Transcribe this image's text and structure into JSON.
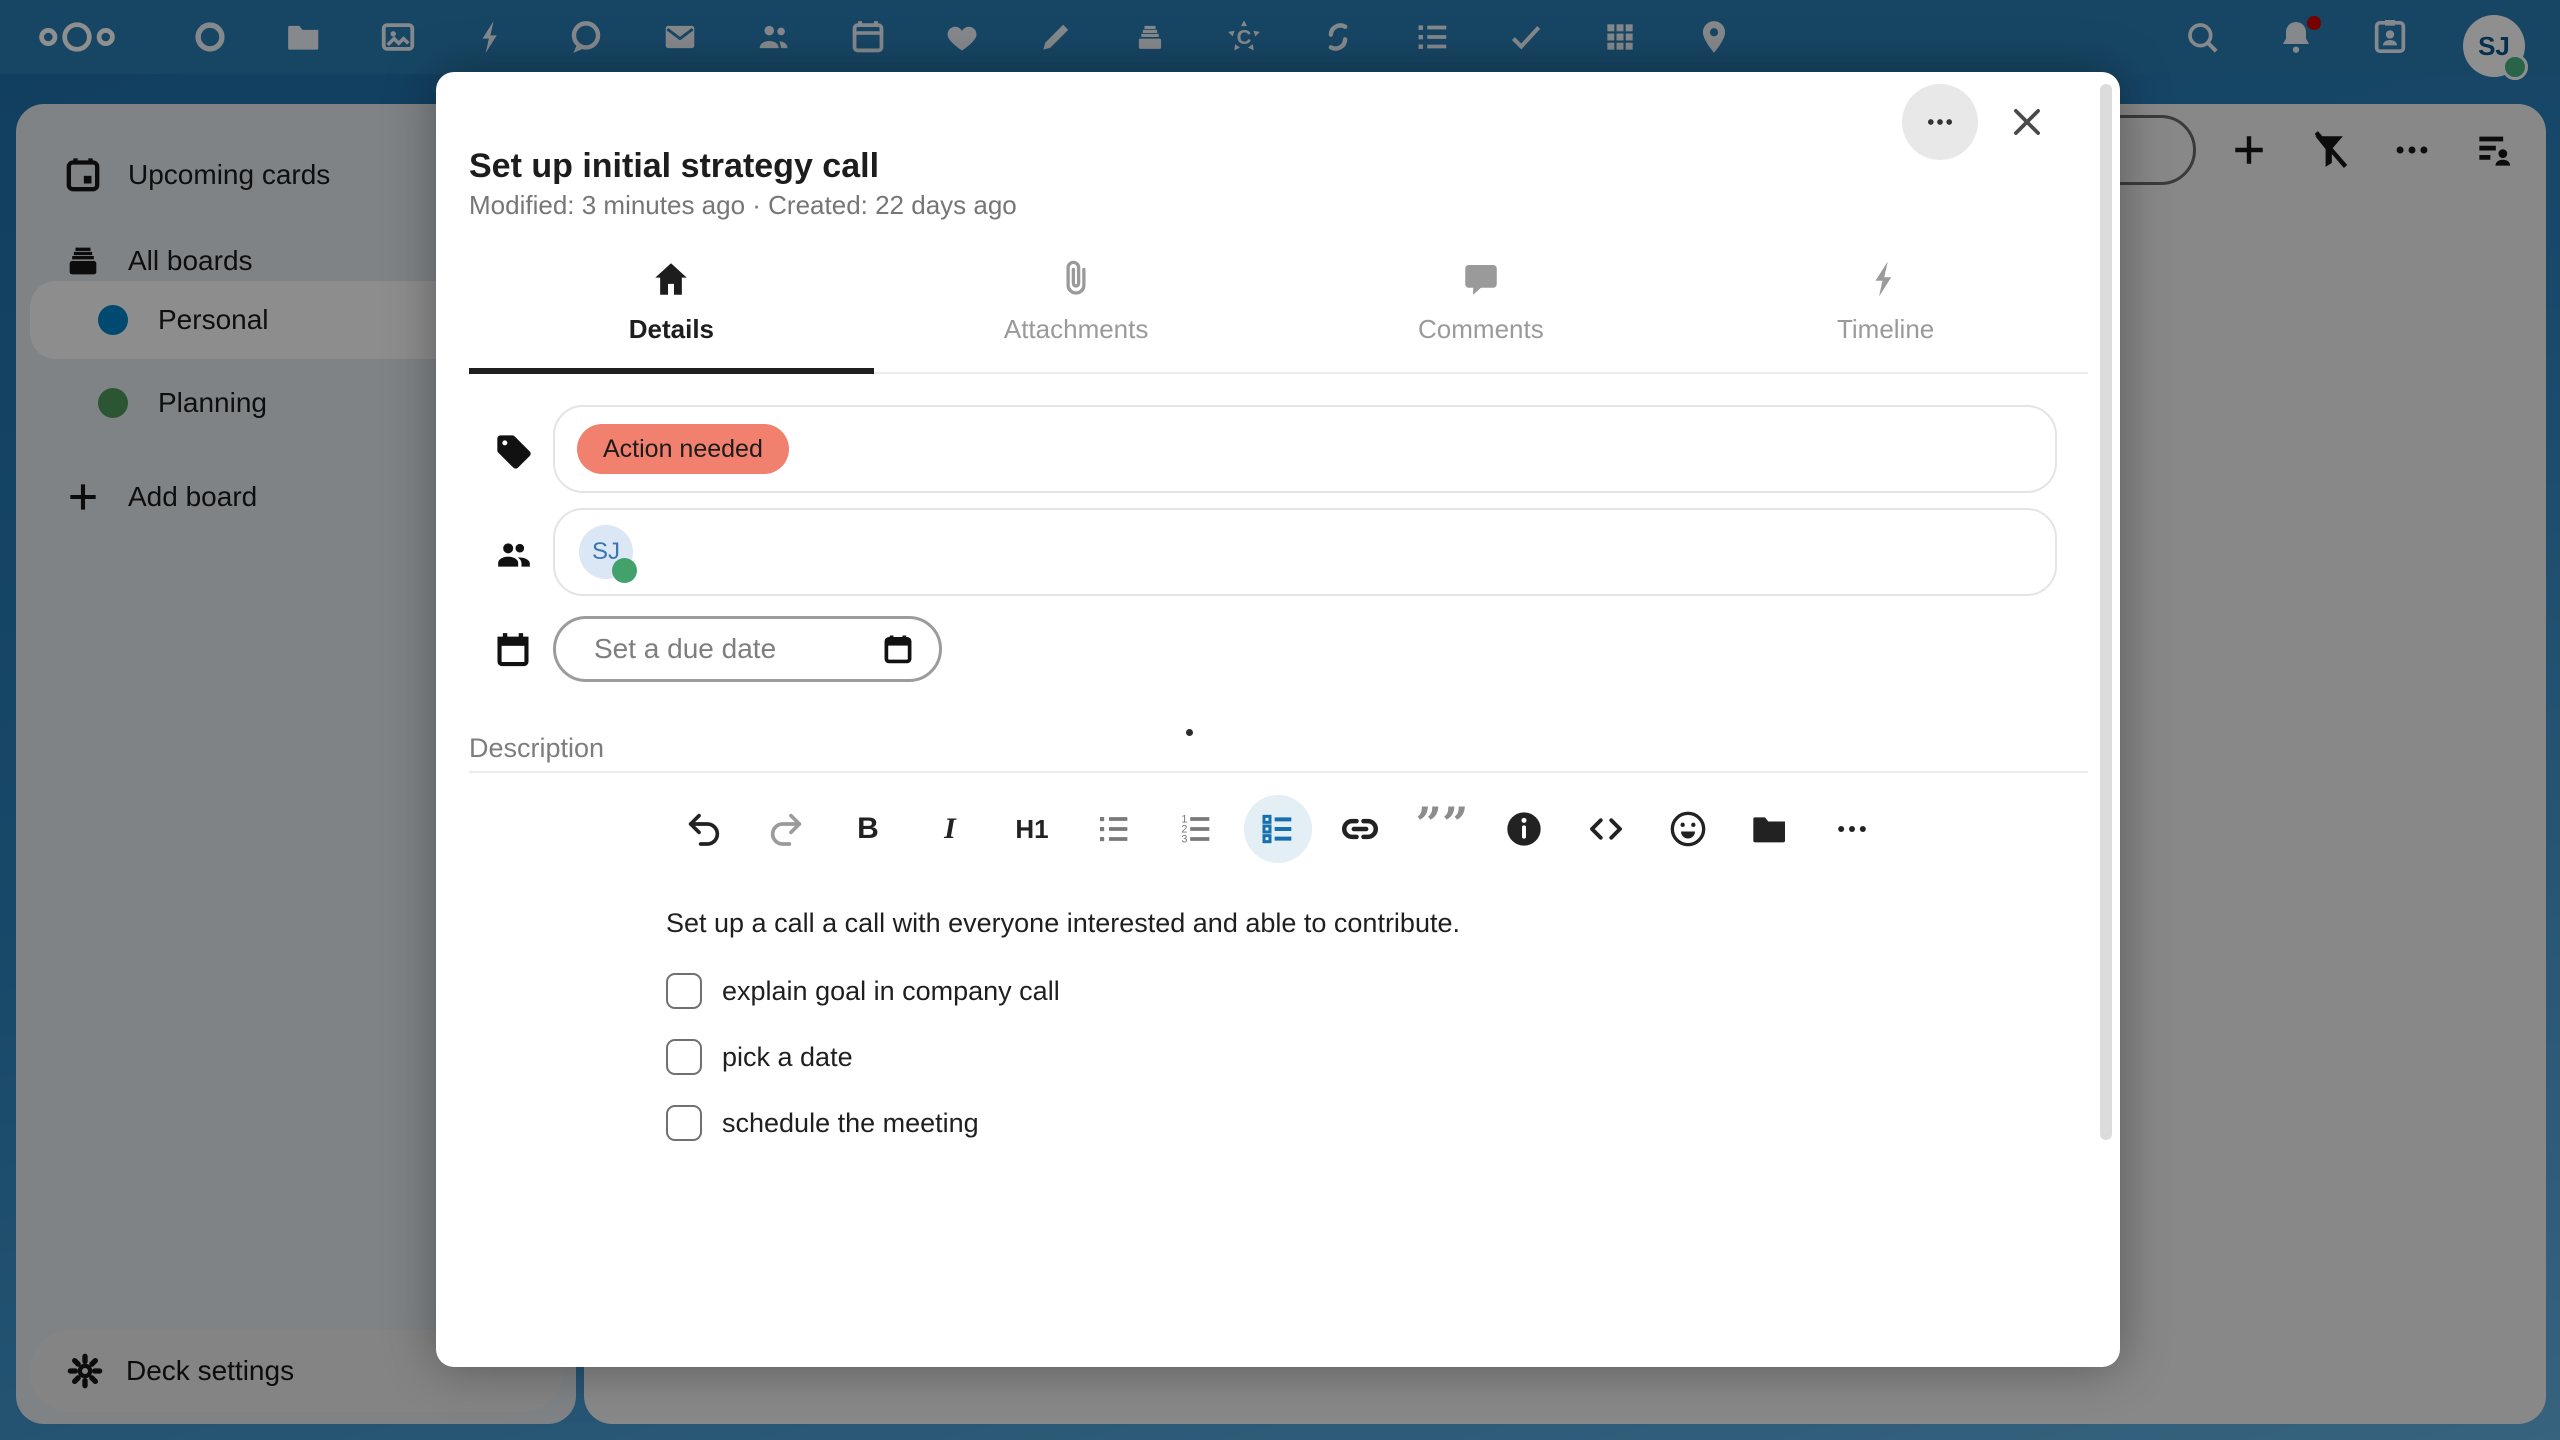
{
  "header": {
    "app_icons": [
      "circle",
      "files",
      "photos",
      "activity",
      "talk",
      "mail",
      "contacts",
      "calendar",
      "favorites",
      "notes",
      "deck",
      "collectives",
      "sync",
      "checklist",
      "tasks",
      "tables",
      "maps"
    ],
    "user": {
      "initials": "SJ",
      "status": "online"
    },
    "colors": {
      "topbar": "#2a7db4",
      "online_green": "#49b382",
      "notification_red": "#d40000"
    }
  },
  "sidebar": {
    "items": [
      {
        "label": "Upcoming cards",
        "icon": "calendar-blank-icon",
        "selected": false
      },
      {
        "label": "All boards",
        "icon": "archive-icon",
        "selected": false
      },
      {
        "label": "Personal",
        "icon": "board-dot",
        "color": "#0082c9",
        "selected": true
      },
      {
        "label": "Planning",
        "icon": "board-dot",
        "color": "#4f9a5c",
        "selected": false
      },
      {
        "label": "Add board",
        "icon": "plus-icon",
        "selected": false
      }
    ],
    "footer": {
      "label": "Deck settings"
    }
  },
  "board_header": {
    "icons": [
      "search-field",
      "add",
      "filter-off",
      "more",
      "sort-by-user"
    ]
  },
  "modal": {
    "title": "Set up initial strategy call",
    "meta": "Modified: 3 minutes ago · Created: 22 days ago",
    "tabs": [
      {
        "label": "Details",
        "icon": "home-icon",
        "active": true
      },
      {
        "label": "Attachments",
        "icon": "paperclip-icon",
        "active": false
      },
      {
        "label": "Comments",
        "icon": "comment-icon",
        "active": false
      },
      {
        "label": "Timeline",
        "icon": "lightning-icon",
        "active": false
      }
    ],
    "tags": {
      "items": [
        {
          "text": "Action needed",
          "color": "#f2806e"
        }
      ]
    },
    "assignees": {
      "items": [
        {
          "initials": "SJ",
          "status": "online",
          "status_color": "#43a16c"
        }
      ]
    },
    "due_date": {
      "placeholder": "Set a due date"
    },
    "description": {
      "label": "Description",
      "text": "Set up a call a call with everyone interested and able to contribute.",
      "checklist": [
        {
          "label": "explain goal in company call",
          "checked": false
        },
        {
          "label": "pick a date",
          "checked": false
        },
        {
          "label": "schedule the meeting",
          "checked": false
        }
      ]
    },
    "toolbar": [
      {
        "name": "undo"
      },
      {
        "name": "redo",
        "disabled": true
      },
      {
        "name": "bold"
      },
      {
        "name": "italic"
      },
      {
        "name": "heading-1"
      },
      {
        "name": "unordered-list"
      },
      {
        "name": "ordered-list"
      },
      {
        "name": "task-list",
        "active": true,
        "accent": "#1670ad"
      },
      {
        "name": "link"
      },
      {
        "name": "blockquote"
      },
      {
        "name": "callout"
      },
      {
        "name": "code-block"
      },
      {
        "name": "emoji"
      },
      {
        "name": "attach-file"
      },
      {
        "name": "more"
      }
    ]
  }
}
